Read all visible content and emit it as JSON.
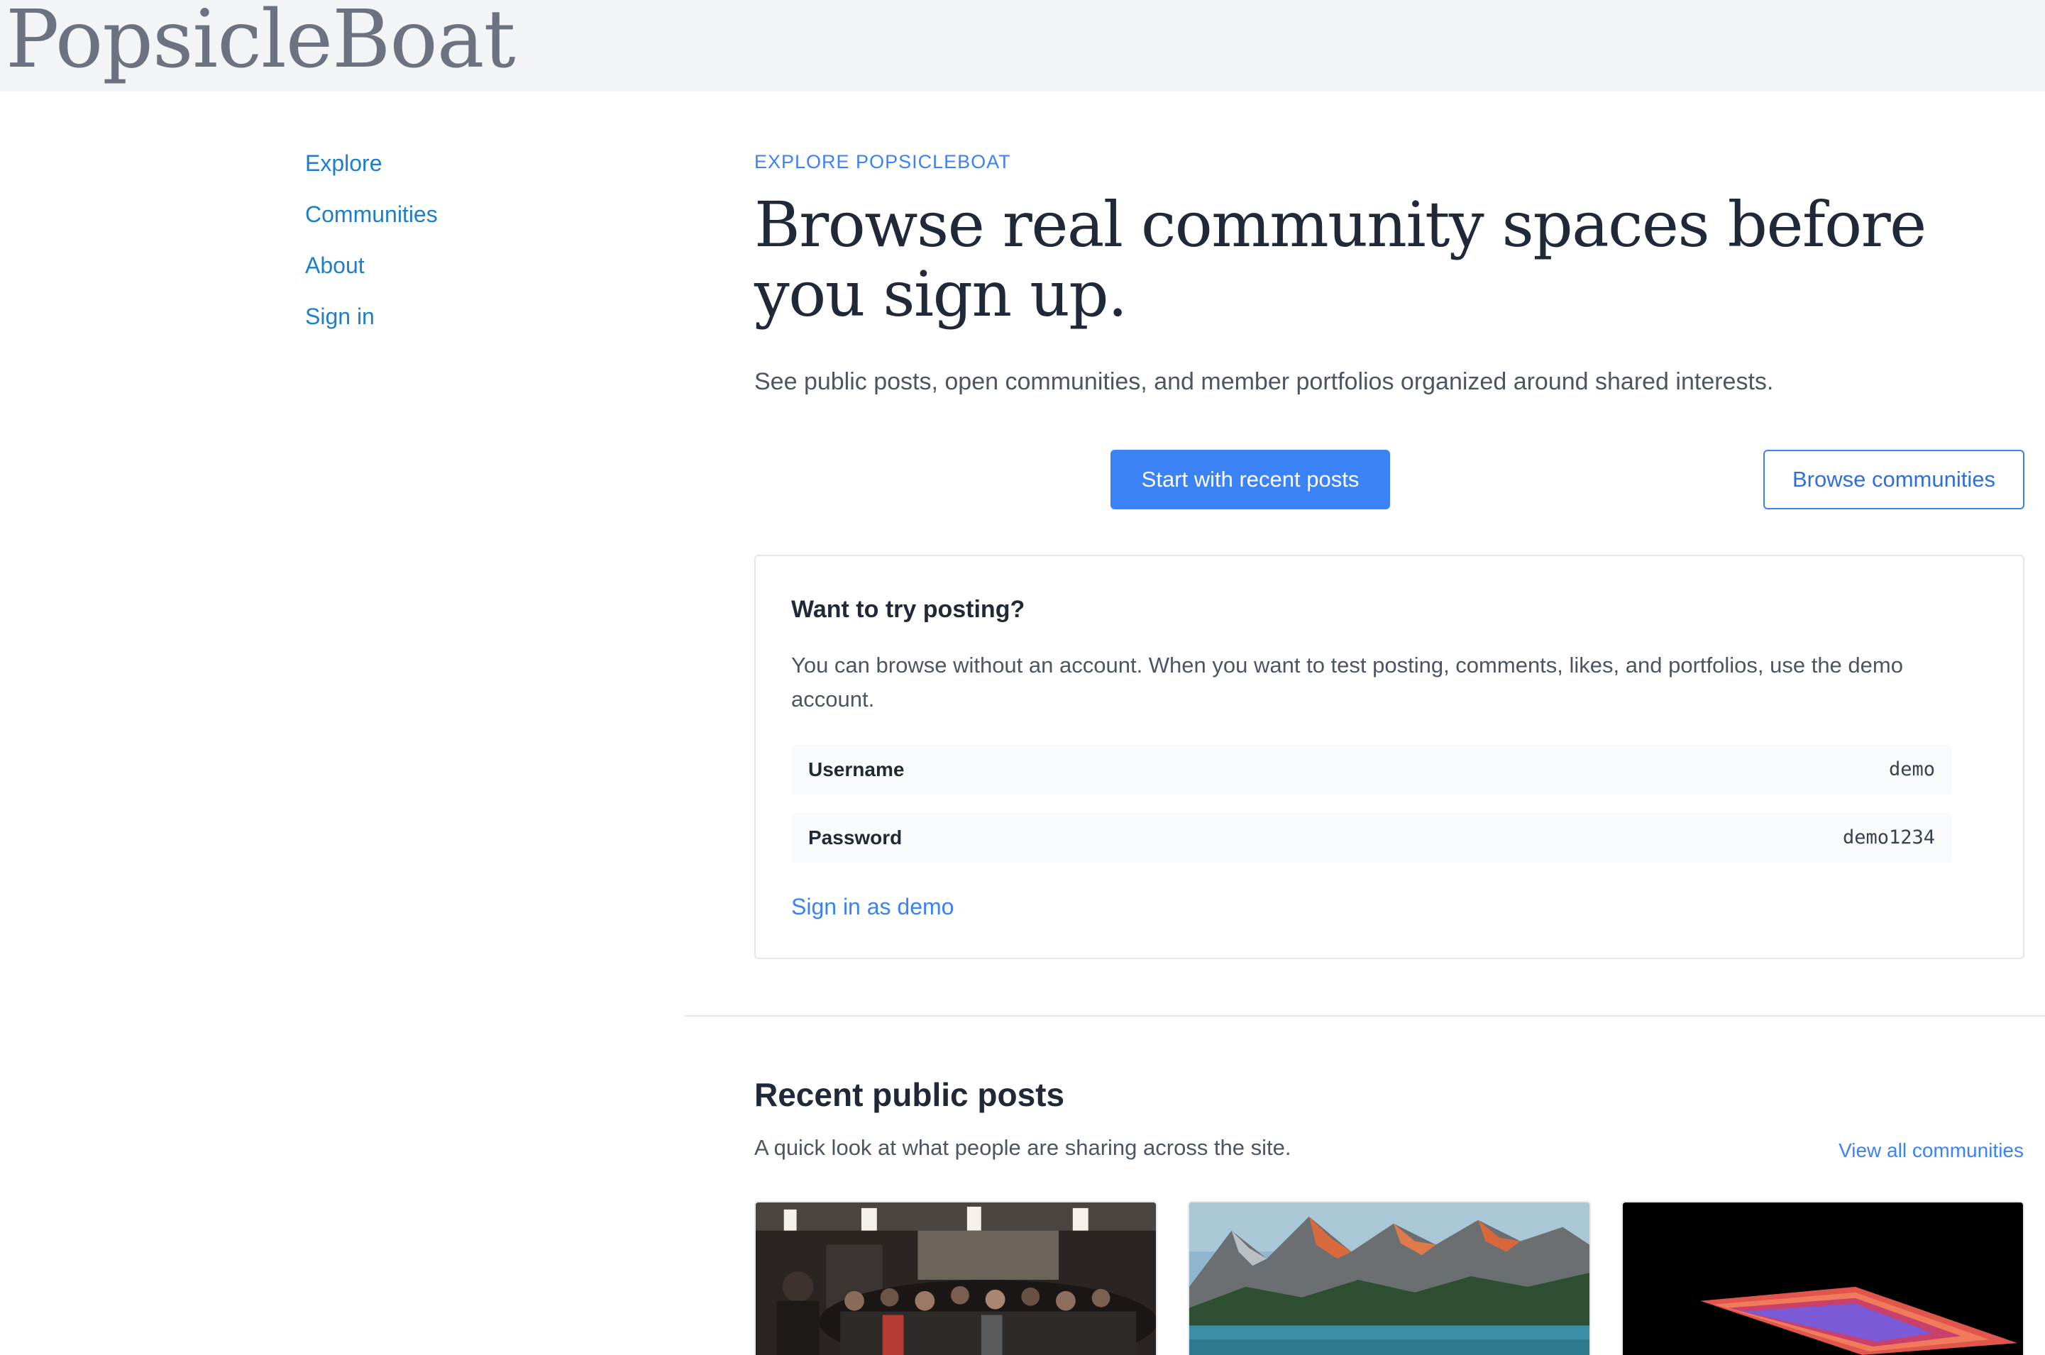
{
  "header": {
    "logo": "PopsicleBoat"
  },
  "sidenav": {
    "items": [
      {
        "label": "Explore"
      },
      {
        "label": "Communities"
      },
      {
        "label": "About"
      },
      {
        "label": "Sign in"
      }
    ]
  },
  "hero": {
    "eyebrow": "EXPLORE POPSICLEBOAT",
    "title": "Browse real community spaces before you sign up.",
    "subtitle": "See public posts, open communities, and member portfolios organized around shared interests.",
    "primary_button": "Start with recent posts",
    "secondary_button": "Browse communities"
  },
  "demo": {
    "title": "Want to try posting?",
    "text": "You can browse without an account. When you want to test posting, comments, likes, and portfolios, use the demo account.",
    "username_label": "Username",
    "username_value": "demo",
    "password_label": "Password",
    "password_value": "demo1234",
    "link": "Sign in as demo"
  },
  "recent": {
    "title": "Recent public posts",
    "subtitle": "A quick look at what people are sharing across the site.",
    "view_all": "View all communities"
  },
  "colors": {
    "accent": "#3b82f6",
    "nav_link": "#1e7fc8",
    "header_bg": "#f3f4f6"
  }
}
